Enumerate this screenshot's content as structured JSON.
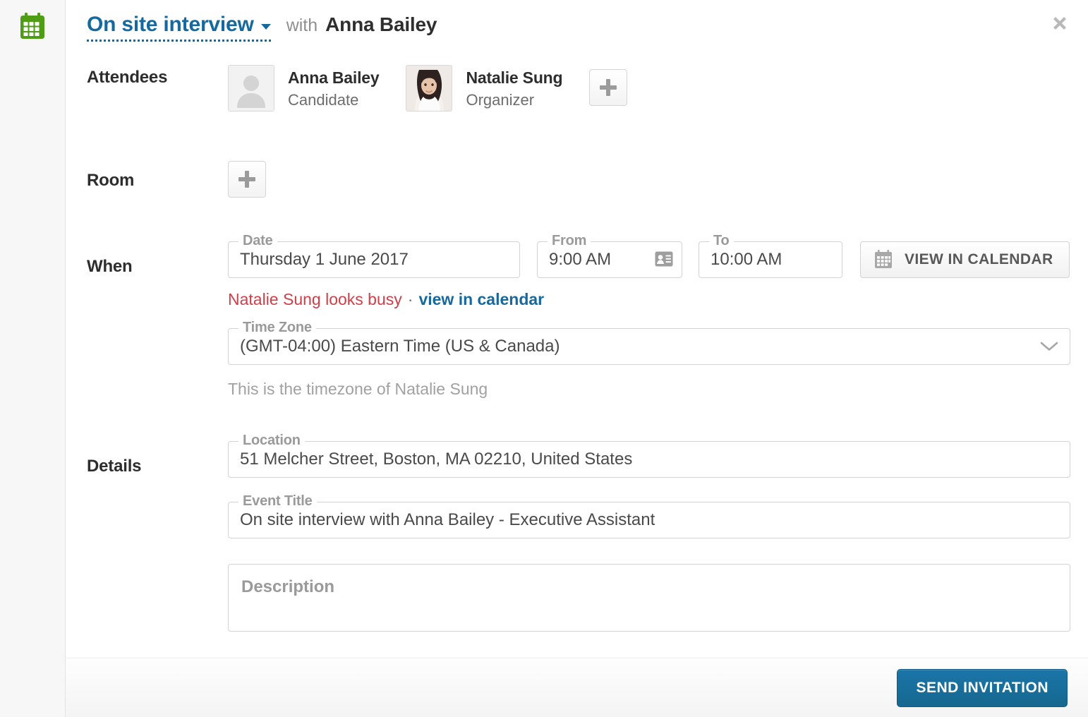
{
  "rail": {
    "icon": "calendar-icon",
    "icon_color": "#4f9c15"
  },
  "header": {
    "event_type": "On site interview",
    "event_type_caret": "chevron-down-icon",
    "with_word": "with",
    "candidate_name": "Anna Bailey",
    "close_icon": "close-icon",
    "accent_color": "#15699e"
  },
  "attendees": {
    "label": "Attendees",
    "people": [
      {
        "name": "Anna Bailey",
        "role": "Candidate",
        "avatar": "person-placeholder-icon"
      },
      {
        "name": "Natalie Sung",
        "role": "Organizer",
        "avatar": "photo"
      }
    ],
    "add_button": "add-attendee-button"
  },
  "room": {
    "label": "Room",
    "add_button": "add-room-button"
  },
  "when": {
    "label": "When",
    "date": {
      "legend": "Date",
      "value": "Thursday 1 June 2017"
    },
    "from": {
      "legend": "From",
      "value": "9:00 AM",
      "icon": "contact-card-icon"
    },
    "to": {
      "legend": "To",
      "value": "10:00 AM"
    },
    "view_in_calendar_button": {
      "label": "VIEW IN CALENDAR",
      "icon": "calendar-icon"
    },
    "busy_notice": {
      "text": "Natalie Sung looks busy",
      "separator": "·",
      "link": "view in calendar",
      "text_color": "#cf3f4a",
      "link_color": "#15699e"
    },
    "time_zone": {
      "legend": "Time Zone",
      "value": "(GMT-04:00) Eastern Time (US & Canada)",
      "chevron": "chevron-down-icon"
    },
    "time_zone_note": "This is the timezone of Natalie Sung"
  },
  "details": {
    "label": "Details",
    "location": {
      "legend": "Location",
      "value": "51 Melcher Street, Boston, MA 02210, United States"
    },
    "event_title": {
      "legend": "Event Title",
      "value": "On site interview with Anna Bailey - Executive Assistant"
    },
    "description": {
      "placeholder": "Description",
      "value": ""
    }
  },
  "footer": {
    "send_label": "SEND INVITATION",
    "send_color": "#15688f"
  }
}
